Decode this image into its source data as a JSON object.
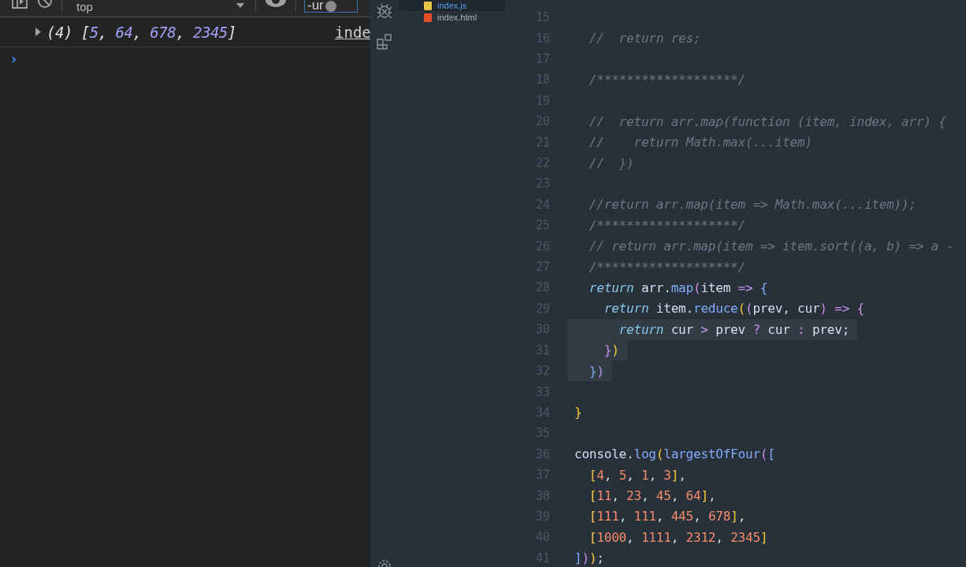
{
  "devtools": {
    "toolbar": {
      "context": "top",
      "filter": {
        "value": "-ur"
      }
    },
    "console": {
      "entries": [
        {
          "expanded": false,
          "parts": [
            {
              "kind": "plain",
              "text": "(4) ["
            },
            {
              "kind": "number",
              "text": "5"
            },
            {
              "kind": "plain",
              "text": ", "
            },
            {
              "kind": "number",
              "text": "64"
            },
            {
              "kind": "plain",
              "text": ", "
            },
            {
              "kind": "number",
              "text": "678"
            },
            {
              "kind": "plain",
              "text": ", "
            },
            {
              "kind": "number",
              "text": "2345"
            },
            {
              "kind": "plain",
              "text": "]"
            }
          ],
          "source": "inde"
        }
      ],
      "prompt": "›"
    }
  },
  "explorer": {
    "files": [
      {
        "name": "index.js",
        "kind": "js",
        "selected": true
      },
      {
        "name": "index.html",
        "kind": "html",
        "selected": false
      }
    ]
  },
  "editor": {
    "lines": [
      {
        "number": "15",
        "selected": false
      },
      {
        "number": "16",
        "selected": false,
        "tokens": [
          {
            "kind": "comment",
            "text": "  //  return res;"
          }
        ]
      },
      {
        "number": "17",
        "selected": false
      },
      {
        "number": "18",
        "selected": false,
        "tokens": [
          {
            "kind": "comment",
            "text": "  /*******************/"
          }
        ]
      },
      {
        "number": "19",
        "selected": false
      },
      {
        "number": "20",
        "selected": false,
        "tokens": [
          {
            "kind": "comment",
            "text": "  //  return arr.map(function (item, index, arr) {"
          }
        ]
      },
      {
        "number": "21",
        "selected": false,
        "tokens": [
          {
            "kind": "comment",
            "text": "  //    return Math.max(...item)"
          }
        ]
      },
      {
        "number": "22",
        "selected": false,
        "tokens": [
          {
            "kind": "comment",
            "text": "  //  })"
          }
        ]
      },
      {
        "number": "23",
        "selected": false
      },
      {
        "number": "24",
        "selected": false,
        "tokens": [
          {
            "kind": "comment",
            "text": "  //return arr.map(item => Math.max(...item));"
          }
        ]
      },
      {
        "number": "25",
        "selected": false,
        "tokens": [
          {
            "kind": "comment",
            "text": "  /*******************/"
          }
        ]
      },
      {
        "number": "26",
        "selected": false,
        "tokens": [
          {
            "kind": "comment",
            "text": "  // return arr.map(item => item.sort((a, b) => a -"
          }
        ]
      },
      {
        "number": "27",
        "selected": false,
        "tokens": [
          {
            "kind": "comment",
            "text": "  /*******************/"
          }
        ]
      },
      {
        "number": "28",
        "selected": false,
        "tokens": [
          {
            "kind": "keyword",
            "text": "  return"
          },
          {
            "kind": "plain",
            "text": " arr."
          },
          {
            "kind": "func",
            "text": "map"
          },
          {
            "kind": "violet",
            "text": "("
          },
          {
            "kind": "plain",
            "text": "item"
          },
          {
            "kind": "operator",
            "text": " => "
          },
          {
            "kind": "blue",
            "text": "{"
          }
        ]
      },
      {
        "number": "29",
        "selected": false,
        "tokens": [
          {
            "kind": "keyword",
            "text": "    return"
          },
          {
            "kind": "plain",
            "text": " item."
          },
          {
            "kind": "func",
            "text": "reduce"
          },
          {
            "kind": "gold",
            "text": "("
          },
          {
            "kind": "violet",
            "text": "("
          },
          {
            "kind": "plain",
            "text": "prev, cur"
          },
          {
            "kind": "violet",
            "text": ")"
          },
          {
            "kind": "operator",
            "text": " => "
          },
          {
            "kind": "violet",
            "text": "{"
          }
        ]
      },
      {
        "number": "30",
        "selected": true,
        "tokens": [
          {
            "kind": "keyword",
            "text": "      return"
          },
          {
            "kind": "plain",
            "text": " cur"
          },
          {
            "kind": "operator",
            "text": " > "
          },
          {
            "kind": "plain",
            "text": "prev"
          },
          {
            "kind": "operator",
            "text": " ? "
          },
          {
            "kind": "plain",
            "text": "cur"
          },
          {
            "kind": "operator",
            "text": " : "
          },
          {
            "kind": "plain",
            "text": "prev;"
          }
        ]
      },
      {
        "number": "31",
        "selected": true,
        "tokens": [
          {
            "kind": "violet",
            "text": "    }"
          },
          {
            "kind": "gold",
            "text": ")"
          }
        ]
      },
      {
        "number": "32",
        "selected": true,
        "tokens": [
          {
            "kind": "blue",
            "text": "  }"
          },
          {
            "kind": "violet",
            "text": ")"
          }
        ]
      },
      {
        "number": "33",
        "selected": false
      },
      {
        "number": "34",
        "selected": false,
        "tokens": [
          {
            "kind": "gold",
            "text": "}"
          }
        ]
      },
      {
        "number": "35",
        "selected": false
      },
      {
        "number": "36",
        "selected": false,
        "tokens": [
          {
            "kind": "plain",
            "text": "console."
          },
          {
            "kind": "func",
            "text": "log"
          },
          {
            "kind": "gold",
            "text": "("
          },
          {
            "kind": "func",
            "text": "largestOfFour"
          },
          {
            "kind": "violet",
            "text": "("
          },
          {
            "kind": "blue",
            "text": "["
          }
        ]
      },
      {
        "number": "37",
        "selected": false,
        "tokens": [
          {
            "kind": "gold",
            "text": "  ["
          },
          {
            "kind": "number",
            "text": "4"
          },
          {
            "kind": "plain",
            "text": ", "
          },
          {
            "kind": "number",
            "text": "5"
          },
          {
            "kind": "plain",
            "text": ", "
          },
          {
            "kind": "number",
            "text": "1"
          },
          {
            "kind": "plain",
            "text": ", "
          },
          {
            "kind": "number",
            "text": "3"
          },
          {
            "kind": "gold",
            "text": "]"
          },
          {
            "kind": "plain",
            "text": ","
          }
        ]
      },
      {
        "number": "38",
        "selected": false,
        "tokens": [
          {
            "kind": "gold",
            "text": "  ["
          },
          {
            "kind": "number",
            "text": "11"
          },
          {
            "kind": "plain",
            "text": ", "
          },
          {
            "kind": "number",
            "text": "23"
          },
          {
            "kind": "plain",
            "text": ", "
          },
          {
            "kind": "number",
            "text": "45"
          },
          {
            "kind": "plain",
            "text": ", "
          },
          {
            "kind": "number",
            "text": "64"
          },
          {
            "kind": "gold",
            "text": "]"
          },
          {
            "kind": "plain",
            "text": ","
          }
        ]
      },
      {
        "number": "39",
        "selected": false,
        "tokens": [
          {
            "kind": "gold",
            "text": "  ["
          },
          {
            "kind": "number",
            "text": "111"
          },
          {
            "kind": "plain",
            "text": ", "
          },
          {
            "kind": "number",
            "text": "111"
          },
          {
            "kind": "plain",
            "text": ", "
          },
          {
            "kind": "number",
            "text": "445"
          },
          {
            "kind": "plain",
            "text": ", "
          },
          {
            "kind": "number",
            "text": "678"
          },
          {
            "kind": "gold",
            "text": "]"
          },
          {
            "kind": "plain",
            "text": ","
          }
        ]
      },
      {
        "number": "40",
        "selected": false,
        "tokens": [
          {
            "kind": "gold",
            "text": "  ["
          },
          {
            "kind": "number",
            "text": "1000"
          },
          {
            "kind": "plain",
            "text": ", "
          },
          {
            "kind": "number",
            "text": "1111"
          },
          {
            "kind": "plain",
            "text": ", "
          },
          {
            "kind": "number",
            "text": "2312"
          },
          {
            "kind": "plain",
            "text": ", "
          },
          {
            "kind": "number",
            "text": "2345"
          },
          {
            "kind": "gold",
            "text": "]"
          }
        ]
      },
      {
        "number": "41",
        "selected": false,
        "tokens": [
          {
            "kind": "blue",
            "text": "]"
          },
          {
            "kind": "violet",
            "text": ")"
          },
          {
            "kind": "gold",
            "text": ")"
          },
          {
            "kind": "plain",
            "text": ";"
          }
        ]
      }
    ]
  }
}
